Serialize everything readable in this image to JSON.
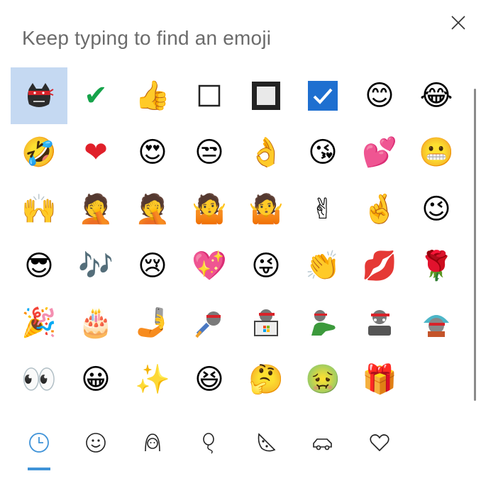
{
  "search": {
    "placeholder": "Keep typing to find an emoji"
  },
  "emojis": [
    {
      "name": "ninja-cat-icon",
      "glyph": "",
      "selected": true
    },
    {
      "name": "check-mark-icon",
      "glyph": "✔",
      "color": "#16a34a"
    },
    {
      "name": "thumbs-up-icon",
      "glyph": "👍"
    },
    {
      "name": "white-square-button-icon",
      "glyph": ""
    },
    {
      "name": "black-square-button-icon",
      "glyph": ""
    },
    {
      "name": "check-box-icon",
      "glyph": ""
    },
    {
      "name": "smiling-face-icon",
      "glyph": "😊"
    },
    {
      "name": "tears-of-joy-icon",
      "glyph": "😂"
    },
    {
      "name": "rolling-on-floor-laughing-icon",
      "glyph": "🤣"
    },
    {
      "name": "red-heart-icon",
      "glyph": "❤",
      "color": "#e0202a"
    },
    {
      "name": "heart-eyes-icon",
      "glyph": "😍"
    },
    {
      "name": "unamused-face-icon",
      "glyph": "😒"
    },
    {
      "name": "ok-hand-icon",
      "glyph": "👌"
    },
    {
      "name": "face-blowing-kiss-icon",
      "glyph": "😘"
    },
    {
      "name": "two-hearts-icon",
      "glyph": "💕"
    },
    {
      "name": "grimacing-face-icon",
      "glyph": "😬"
    },
    {
      "name": "raising-hands-icon",
      "glyph": "🙌"
    },
    {
      "name": "woman-facepalming-icon",
      "glyph": "🤦"
    },
    {
      "name": "man-facepalming-icon",
      "glyph": "🤦"
    },
    {
      "name": "woman-shrugging-icon",
      "glyph": "🤷"
    },
    {
      "name": "man-shrugging-icon",
      "glyph": "🤷"
    },
    {
      "name": "victory-hand-icon",
      "glyph": "✌"
    },
    {
      "name": "crossed-fingers-icon",
      "glyph": "🤞"
    },
    {
      "name": "winking-face-icon",
      "glyph": "😉"
    },
    {
      "name": "sunglasses-face-icon",
      "glyph": "😎"
    },
    {
      "name": "musical-notes-icon",
      "glyph": "🎶"
    },
    {
      "name": "crying-face-icon",
      "glyph": "😢"
    },
    {
      "name": "sparkling-heart-icon",
      "glyph": "💖"
    },
    {
      "name": "winking-tongue-face-icon",
      "glyph": "😜"
    },
    {
      "name": "clapping-hands-icon",
      "glyph": "👏"
    },
    {
      "name": "kiss-mark-icon",
      "glyph": "💋"
    },
    {
      "name": "rose-icon",
      "glyph": "🌹"
    },
    {
      "name": "party-popper-icon",
      "glyph": "🎉"
    },
    {
      "name": "birthday-cake-icon",
      "glyph": "🎂"
    },
    {
      "name": "selfie-icon",
      "glyph": "🤳"
    },
    {
      "name": "ninja-cat-rocket-icon",
      "glyph": ""
    },
    {
      "name": "ninja-cat-laptop-icon",
      "glyph": ""
    },
    {
      "name": "ninja-cat-dinosaur-icon",
      "glyph": ""
    },
    {
      "name": "ninja-cat-astro-icon",
      "glyph": ""
    },
    {
      "name": "ninja-cat-hipster-icon",
      "glyph": ""
    },
    {
      "name": "eyes-icon",
      "glyph": "👀"
    },
    {
      "name": "grinning-face-icon",
      "glyph": "😀"
    },
    {
      "name": "sparkles-icon",
      "glyph": "✨"
    },
    {
      "name": "squinting-laughing-face-icon",
      "glyph": "😆"
    },
    {
      "name": "thinking-face-icon",
      "glyph": "🤔"
    },
    {
      "name": "nauseated-face-icon",
      "glyph": "🤢"
    },
    {
      "name": "wrapped-gift-icon",
      "glyph": "🎁"
    }
  ],
  "tabs": [
    {
      "name": "recent-clock-icon",
      "active": true
    },
    {
      "name": "smiley-face-icon"
    },
    {
      "name": "person-icon"
    },
    {
      "name": "balloon-icon"
    },
    {
      "name": "pizza-icon"
    },
    {
      "name": "car-icon"
    },
    {
      "name": "heart-icon"
    }
  ],
  "colors": {
    "accent": "#3f93d8",
    "selected_bg": "#c5d9f2",
    "hint_text": "#6b6b6b"
  }
}
